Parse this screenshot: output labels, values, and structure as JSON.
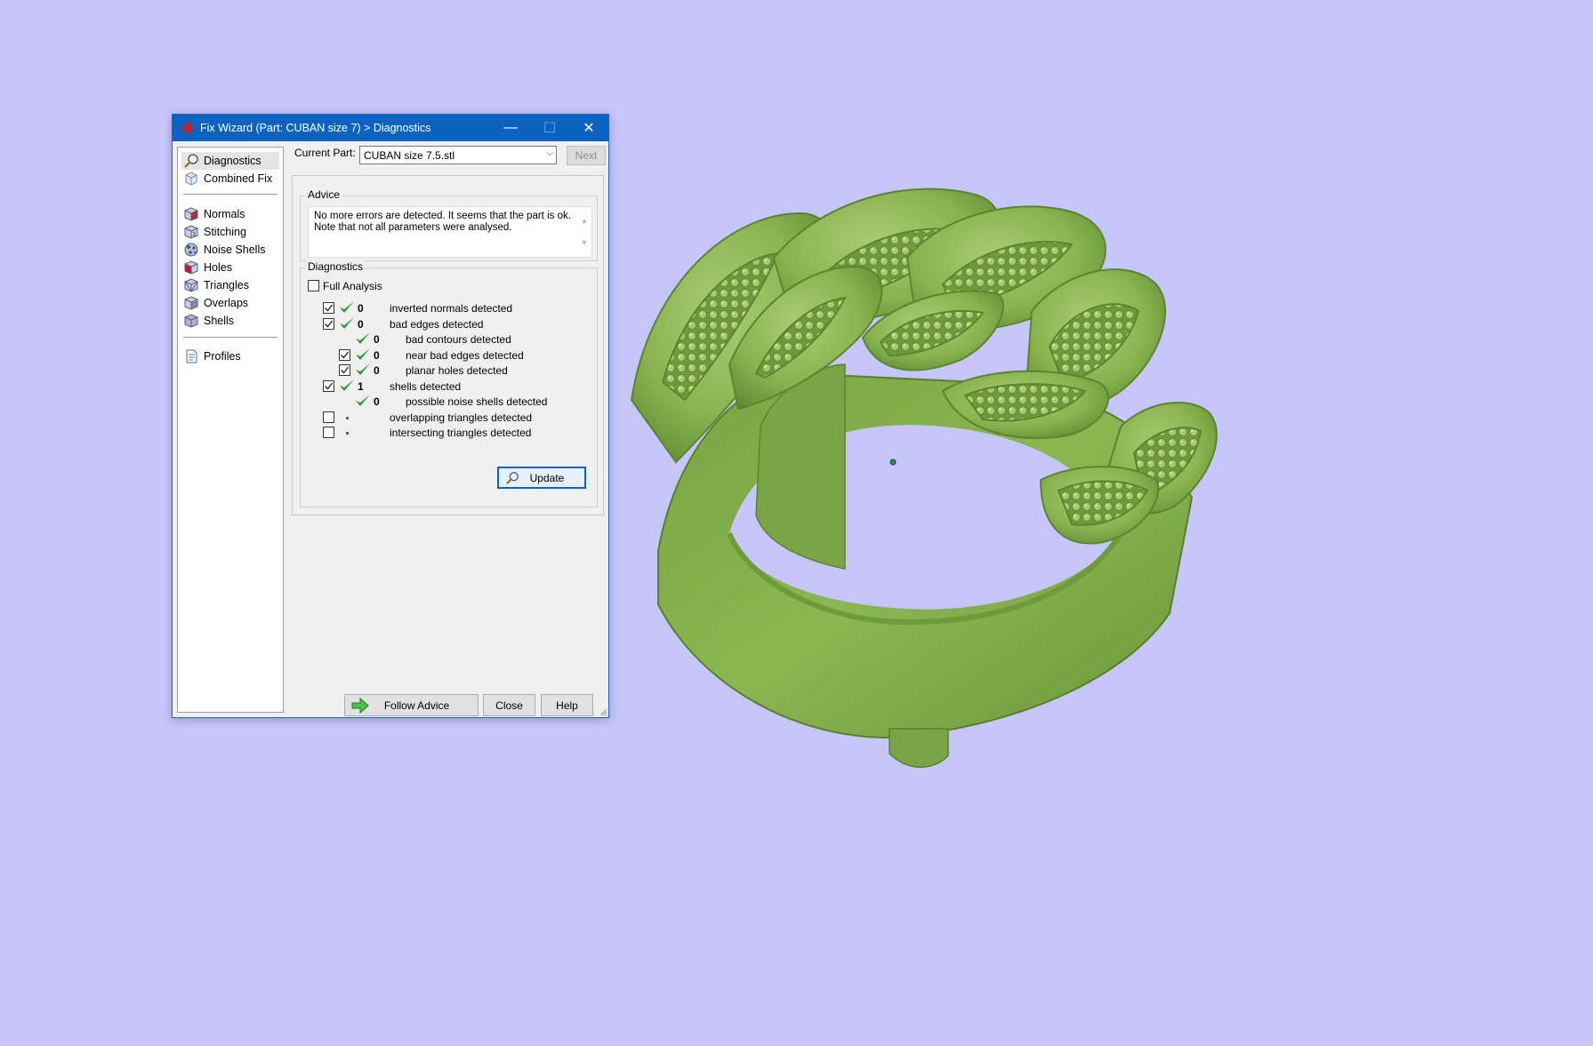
{
  "window": {
    "title": "Fix Wizard (Part: CUBAN size 7) > Diagnostics",
    "controls": {
      "minimize": "—",
      "maximize": "☐",
      "close": "✕"
    }
  },
  "nav": {
    "items": [
      {
        "label": "Diagnostics",
        "icon": "magnifier-icon",
        "selected": true
      },
      {
        "label": "Combined Fix",
        "icon": "combined-fix-icon"
      },
      {
        "label": "Normals",
        "icon": "normals-cube-icon"
      },
      {
        "label": "Stitching",
        "icon": "stitching-cube-icon"
      },
      {
        "label": "Noise Shells",
        "icon": "noise-shells-icon"
      },
      {
        "label": "Holes",
        "icon": "holes-cube-icon"
      },
      {
        "label": "Triangles",
        "icon": "triangles-cube-icon"
      },
      {
        "label": "Overlaps",
        "icon": "overlaps-cube-icon"
      },
      {
        "label": "Shells",
        "icon": "shells-cube-icon"
      },
      {
        "label": "Profiles",
        "icon": "profiles-document-icon"
      }
    ]
  },
  "current_part": {
    "label": "Current Part:",
    "value": "CUBAN size 7.5.stl"
  },
  "next_label": "Next",
  "advice": {
    "title": "Advice",
    "lines": [
      "No more errors are detected. It seems that the part is ok.",
      "Note that not all parameters were analysed."
    ]
  },
  "diagnostics": {
    "title": "Diagnostics",
    "full_analysis": {
      "label": "Full Analysis",
      "checked": false
    },
    "rows": [
      {
        "checkbox": true,
        "checked": true,
        "status": "ok",
        "count": "0",
        "label": "inverted normals detected",
        "indent": 0
      },
      {
        "checkbox": true,
        "checked": true,
        "status": "ok",
        "count": "0",
        "label": "bad edges detected",
        "indent": 0
      },
      {
        "checkbox": false,
        "checked": false,
        "status": "ok",
        "count": "0",
        "label": "bad contours detected",
        "indent": 1
      },
      {
        "checkbox": true,
        "checked": true,
        "status": "ok",
        "count": "0",
        "label": "near bad edges detected",
        "indent": 1
      },
      {
        "checkbox": true,
        "checked": true,
        "status": "ok",
        "count": "0",
        "label": "planar holes detected",
        "indent": 1
      },
      {
        "checkbox": true,
        "checked": true,
        "status": "ok",
        "count": "1",
        "label": "shells detected",
        "indent": 0
      },
      {
        "checkbox": false,
        "checked": false,
        "status": "ok",
        "count": "0",
        "label": "possible noise shells detected",
        "indent": 1
      },
      {
        "checkbox": true,
        "checked": false,
        "status": "none",
        "count": "",
        "label": "overlapping triangles detected",
        "indent": 0
      },
      {
        "checkbox": true,
        "checked": false,
        "status": "none",
        "count": "",
        "label": "intersecting triangles detected",
        "indent": 0
      }
    ],
    "update_label": "Update"
  },
  "buttons": {
    "follow_advice": "Follow Advice",
    "close": "Close",
    "help": "Help"
  },
  "viewport": {
    "object": "CUBAN size 7.5 ring",
    "model_color": "#88b34f",
    "background": "#c6c6fd"
  },
  "colors": {
    "titlebar": "#0a63c0",
    "check_green": "#2e9a3e"
  }
}
